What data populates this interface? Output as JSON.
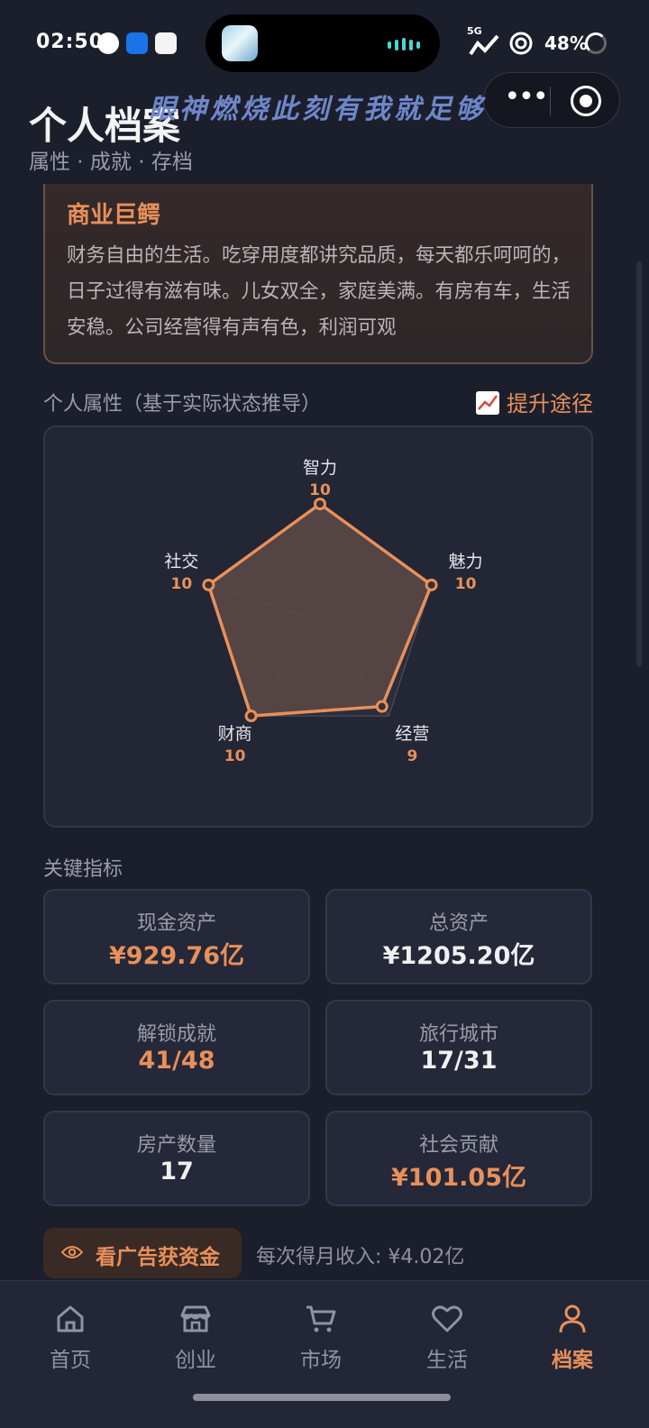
{
  "status_bar": {
    "time": "02:50",
    "network": "5G",
    "battery": "48%"
  },
  "overlay": {
    "text": "眼神燃烧此刻有我就足够"
  },
  "header": {
    "title": "个人档案",
    "subtitle": "属性 · 成就 · 存档"
  },
  "title_card": {
    "name": "商业巨鳄",
    "description": "财务自由的生活。吃穿用度都讲究品质，每天都乐呵呵的，日子过得有滋有味。儿女双全，家庭美满。有房有车，生活安稳。公司经营得有声有色，利润可观"
  },
  "attributes": {
    "label": "个人属性（基于实际状态推导）",
    "improve_link": "提升途径"
  },
  "chart_data": {
    "type": "radar",
    "categories": [
      "智力",
      "魅力",
      "经营",
      "财商",
      "社交"
    ],
    "values": [
      10,
      10,
      9,
      10,
      10
    ],
    "value_labels": [
      "10",
      "10",
      "9",
      "10",
      "10"
    ],
    "ylim": [
      0,
      10
    ],
    "grid_levels": 5,
    "colors": {
      "line": "#e8905a",
      "fill": "#5c4844",
      "grid": "#4b4f5e"
    }
  },
  "key_metrics": {
    "label": "关键指标",
    "cards": [
      {
        "label": "现金资产",
        "value": "¥929.76亿"
      },
      {
        "label": "总资产",
        "value": "¥1205.20亿"
      },
      {
        "label": "解锁成就",
        "value": "41/48"
      },
      {
        "label": "旅行城市",
        "value": "17/31"
      },
      {
        "label": "房产数量",
        "value": "17"
      },
      {
        "label": "社会贡献",
        "value": "¥101.05亿"
      }
    ]
  },
  "ad": {
    "button_label": "看广告获资金",
    "note": "每次得月收入: ¥4.02亿"
  },
  "tabbar": {
    "items": [
      {
        "label": "首页",
        "icon": "home-icon"
      },
      {
        "label": "创业",
        "icon": "store-icon"
      },
      {
        "label": "市场",
        "icon": "cart-icon"
      },
      {
        "label": "生活",
        "icon": "heart-icon"
      },
      {
        "label": "档案",
        "icon": "person-icon"
      }
    ],
    "active_index": 4
  },
  "colors": {
    "accent": "#e8905a",
    "background": "#1b1f2c",
    "panel": "#242839"
  }
}
